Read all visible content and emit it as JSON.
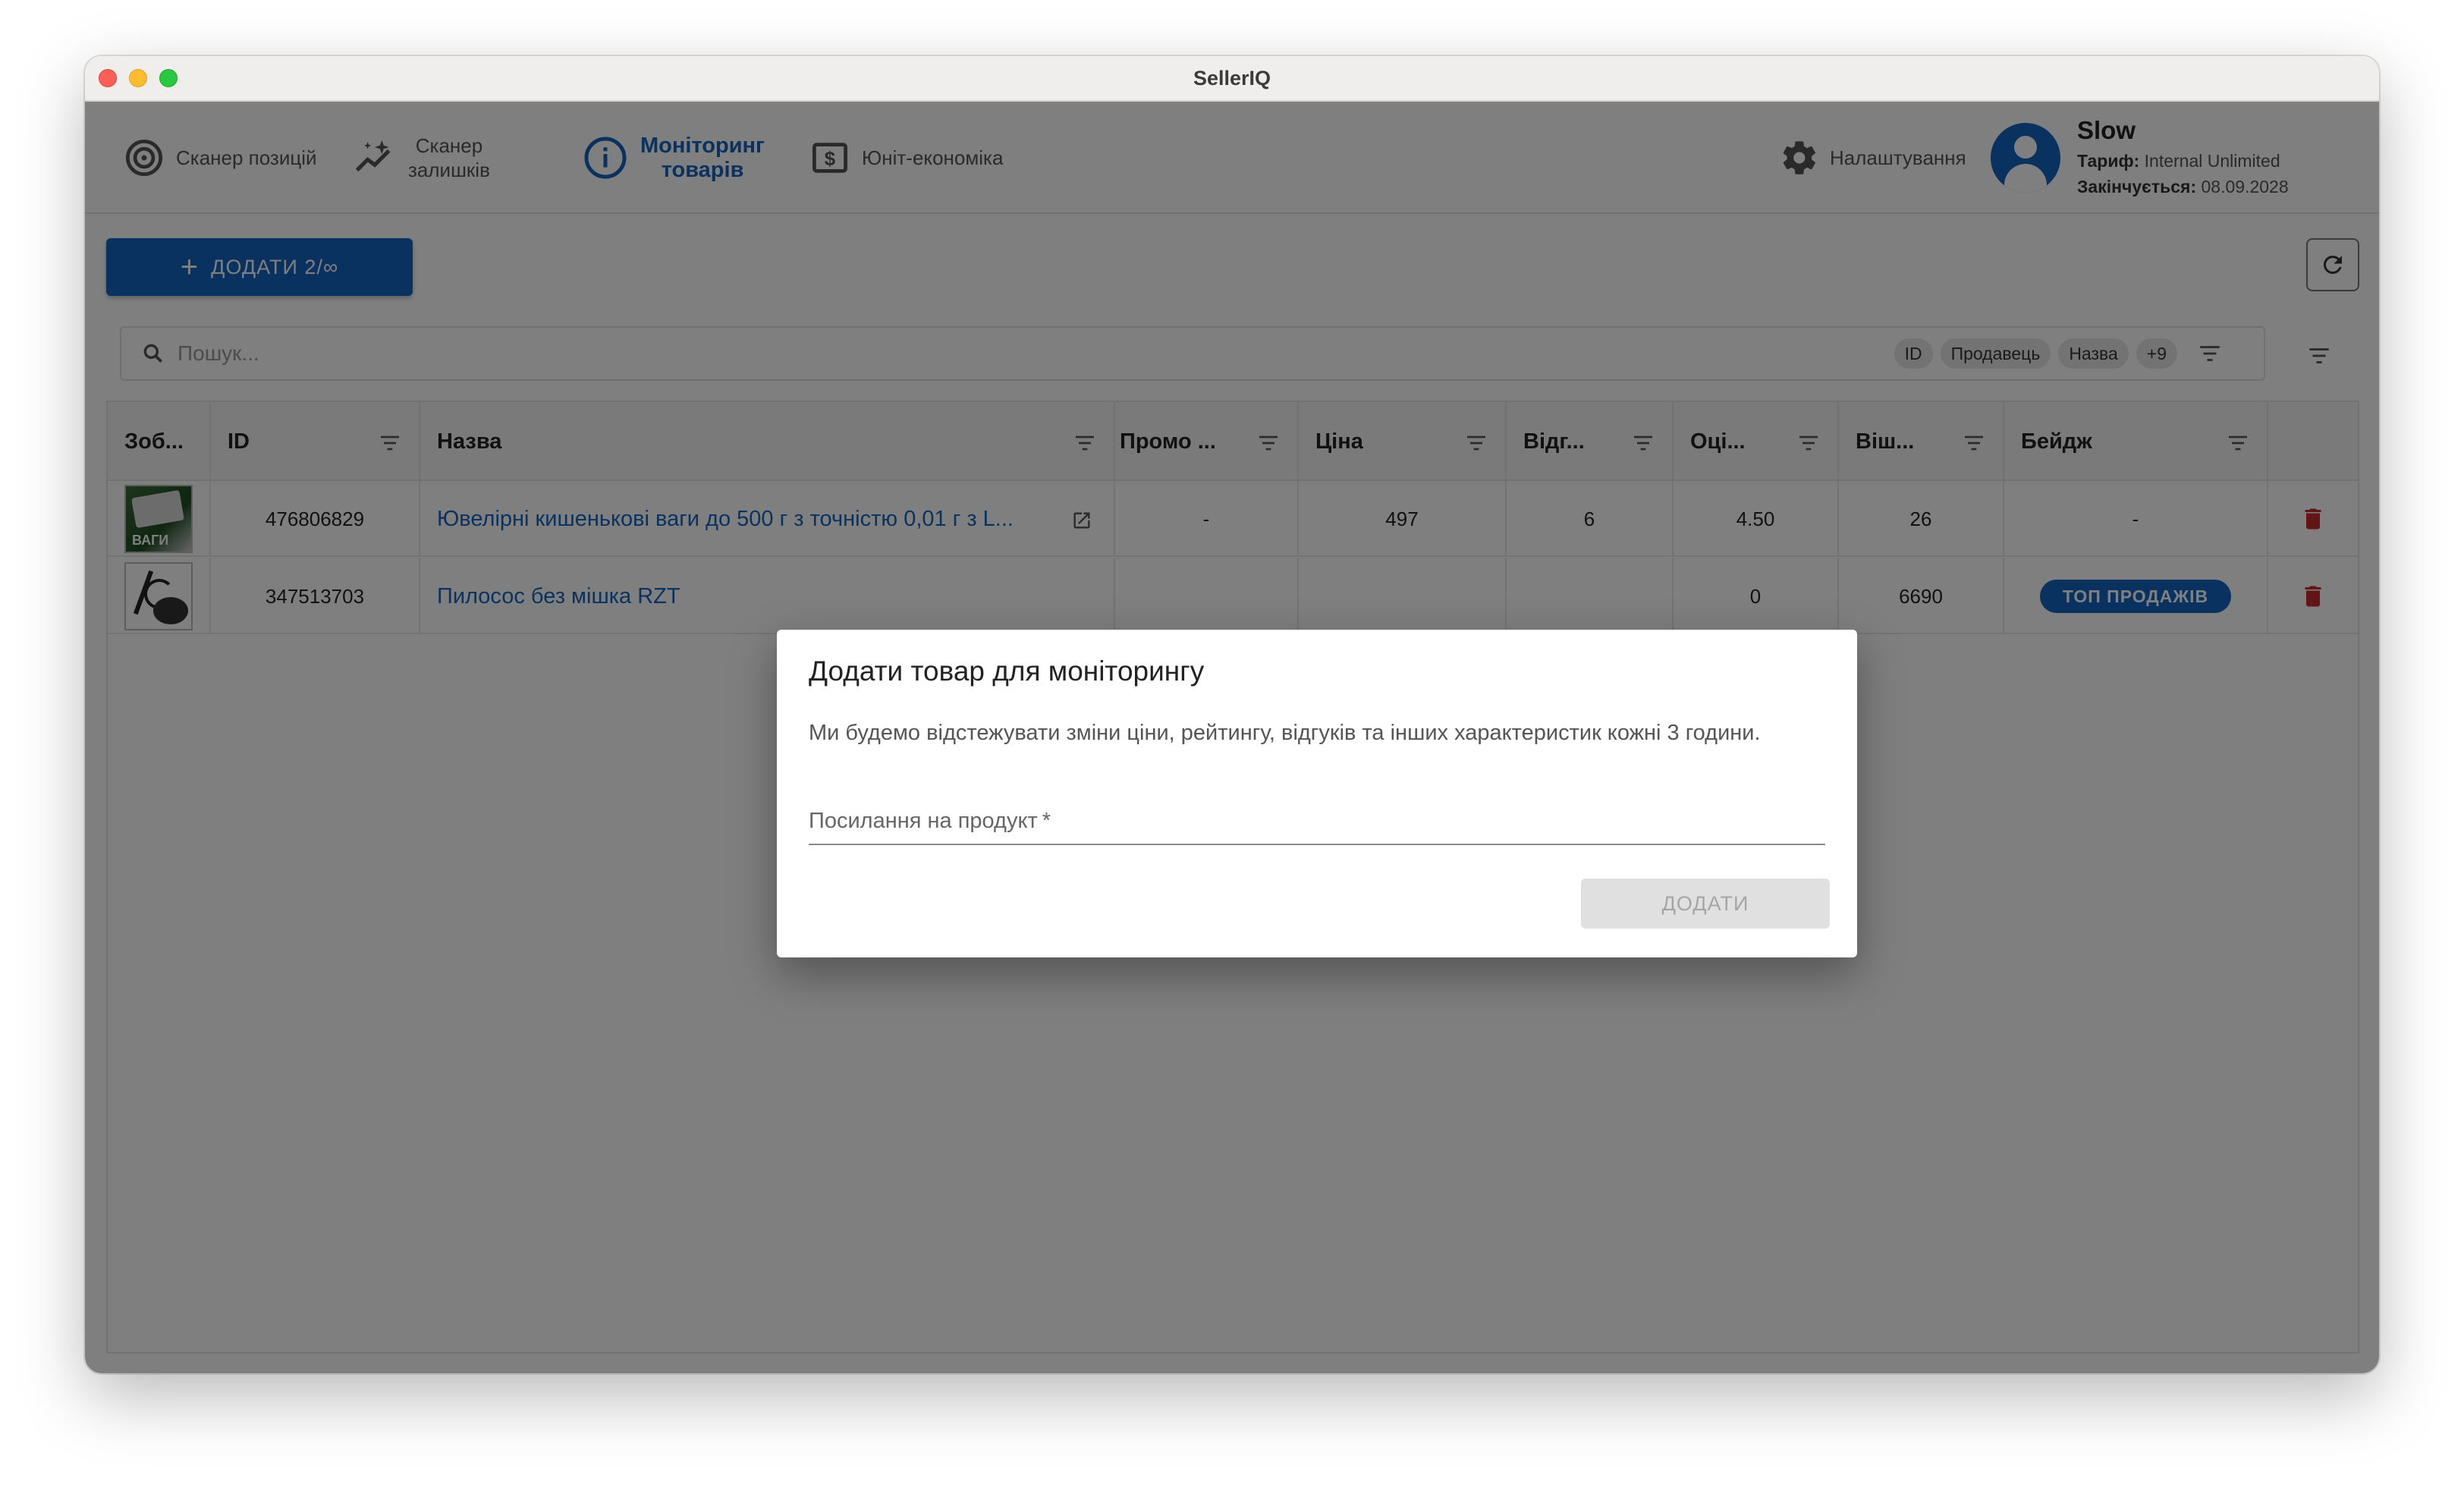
{
  "window": {
    "title": "SellerIQ"
  },
  "nav": {
    "items": [
      {
        "label": "Сканер позицій",
        "icon": "target-icon"
      },
      {
        "label_line1": "Сканер",
        "label_line2": "залишків",
        "icon": "sparkle-chart-icon"
      },
      {
        "label_line1": "Моніторинг",
        "label_line2": "товарів",
        "icon": "info-icon",
        "active": true
      },
      {
        "label": "Юніт-економіка",
        "icon": "dollar-icon"
      }
    ],
    "settings_label": "Налаштування"
  },
  "user": {
    "name": "Slow",
    "plan_label": "Тариф:",
    "plan_value": "Internal Unlimited",
    "expires_label": "Закінчується:",
    "expires_value": "08.09.2028"
  },
  "toolbar": {
    "add_label": "ДОДАТИ 2/∞"
  },
  "search": {
    "placeholder": "Пошук...",
    "chips": [
      "ID",
      "Продавець",
      "Назва",
      "+9"
    ]
  },
  "table": {
    "columns": [
      "Зоб...",
      "ID",
      "Назва",
      "Промо ...",
      "Ціна",
      "Відг...",
      "Оці...",
      "Віш...",
      "Бейдж"
    ],
    "rows": [
      {
        "id": "476806829",
        "name": "Ювелірні кишенькові ваги до 500 г з точністю 0,01 г з L...",
        "thumb_text": "ВАГИ",
        "promo": "-",
        "price": "497",
        "reviews": "6",
        "rating": "4.50",
        "wishlist": "26",
        "badge": "-"
      },
      {
        "id": "347513703",
        "name": "Пилосос без мішка RZT",
        "promo": "",
        "price": "",
        "reviews": "",
        "rating": "0",
        "wishlist": "6690",
        "badge": "ТОП ПРОДАЖІВ"
      }
    ]
  },
  "dialog": {
    "title": "Додати товар для моніторингу",
    "text": "Ми будемо відстежувати зміни ціни, рейтингу, відгуків та інших характеристик кожні 3 години.",
    "field_label": "Посилання на продукт",
    "field_required": "*",
    "submit_label": "ДОДАТИ"
  },
  "colors": {
    "accent": "#1565c0",
    "delete": "#c62828"
  }
}
